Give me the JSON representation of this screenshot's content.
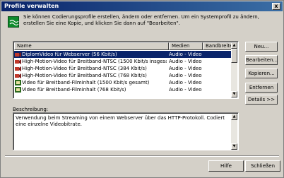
{
  "window": {
    "title": "Profile verwalten",
    "close_label": "x"
  },
  "info": {
    "text": "Sie können Codierungsprofile erstellen, ändern oder entfernen. Um ein Systemprofil zu ändern, erstellen Sie eine Kopie, und klicken Sie dann auf \"Bearbeiten\"."
  },
  "list": {
    "columns": [
      "Name",
      "Medien",
      "Bandbreite zu"
    ],
    "rows": [
      {
        "name": "DiplomVideo für Webserver (56 Kbit/s)",
        "media": "Audio - Video",
        "icon": "camera-icon",
        "selected": true
      },
      {
        "name": "High-Motion-Video für Breitband-NTSC (1500 Kbit/s insgesamt)",
        "media": "Audio - Video",
        "icon": "camera-icon",
        "selected": false
      },
      {
        "name": "High-Motion-Video für Breitband-NTSC (384 Kbit/s)",
        "media": "Audio - Video",
        "icon": "camera-icon",
        "selected": false
      },
      {
        "name": "High-Motion-Video für Breitband-NTSC (768 Kbit/s)",
        "media": "Audio - Video",
        "icon": "camera-icon",
        "selected": false
      },
      {
        "name": "Video für Breitband-Filminhalt (1500 Kbit/s gesamt)",
        "media": "Audio - Video",
        "icon": "film-icon",
        "selected": false
      },
      {
        "name": "Video für Breitband-Filminhalt (768 Kbit/s)",
        "media": "Audio - Video",
        "icon": "film-icon",
        "selected": false
      }
    ]
  },
  "buttons": {
    "new": "Neu...",
    "edit": "Bearbeiten...",
    "copy": "Kopieren...",
    "remove": "Entfernen",
    "details": "Details >>",
    "help": "Hilfe",
    "close": "Schließen"
  },
  "description": {
    "label": "Beschreibung:",
    "text": "Verwendung beim Streaming von einem Webserver über das HTTP-Protokoll. Codiert eine einzelne Videobitrate."
  },
  "colors": {
    "selection": "#0a246a",
    "face": "#d4d0c8",
    "title_start": "#0a246a",
    "title_end": "#3a6ea5"
  }
}
